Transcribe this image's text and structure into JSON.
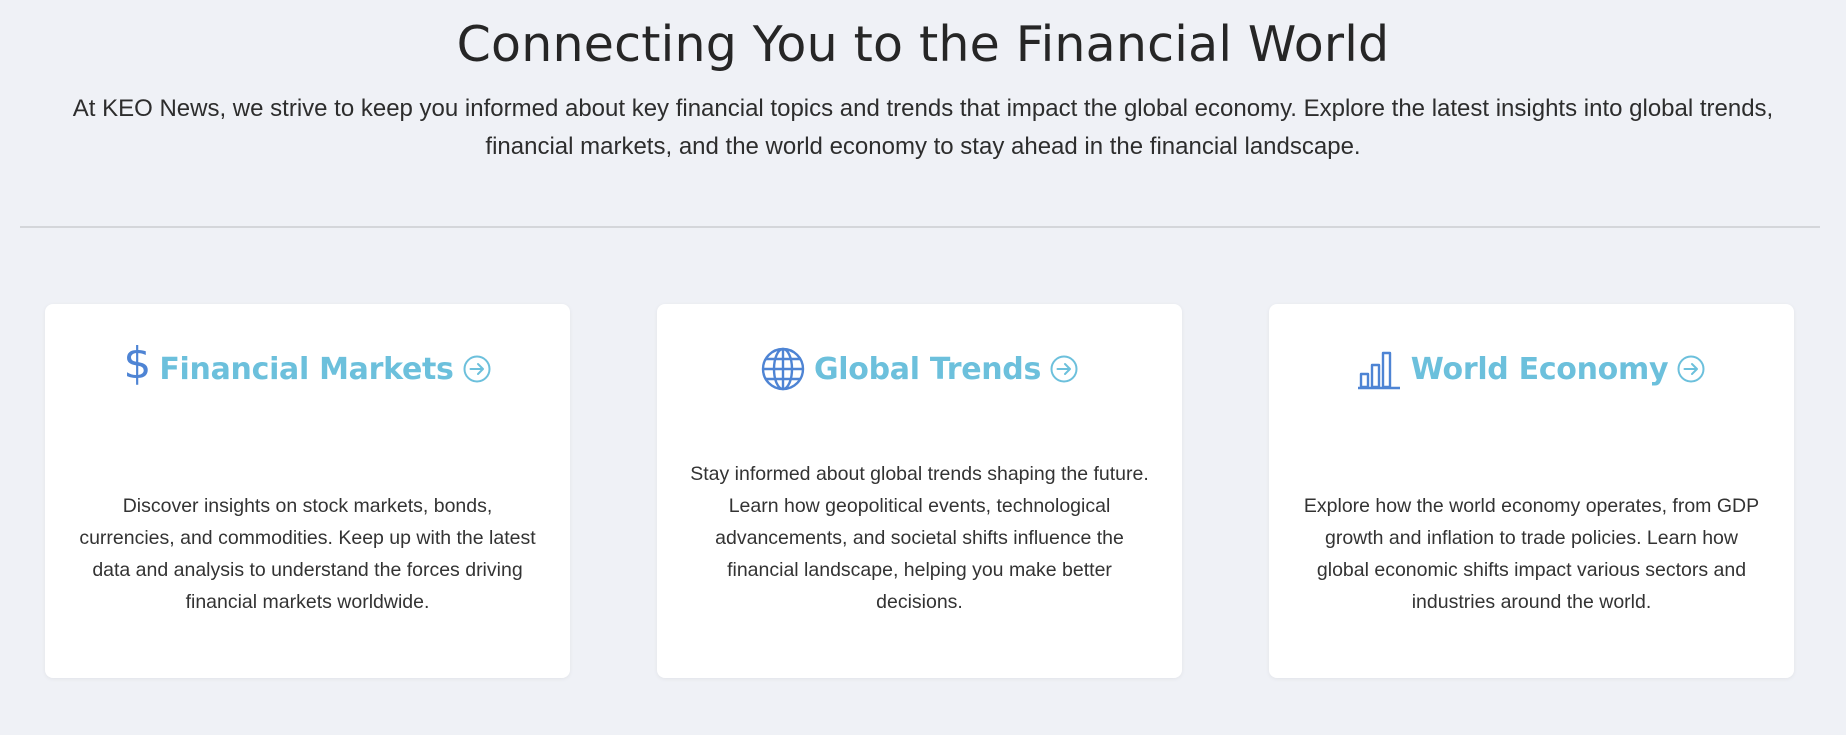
{
  "hero": {
    "title": "Connecting You to the Financial World",
    "subtitle": "At KEO News, we strive to keep you informed about key financial topics and trends that impact the global economy. Explore the latest insights into global trends, financial markets, and the world economy to stay ahead in the financial landscape."
  },
  "colors": {
    "background": "#eff1f6",
    "title_accent": "#6cc0dc",
    "icon_blue": "#4e84d4",
    "card_background": "#ffffff"
  },
  "cards": [
    {
      "icon": "dollar-icon",
      "title": "Financial Markets",
      "body": "Discover insights on stock markets, bonds, currencies, and commodities. Keep up with the latest data and analysis to understand the forces driving financial markets worldwide."
    },
    {
      "icon": "globe-icon",
      "title": "Global Trends",
      "body": "Stay informed about global trends shaping the future. Learn how geopolitical events, technological advancements, and societal shifts influence the financial landscape, helping you make better decisions."
    },
    {
      "icon": "bar-chart-icon",
      "title": "World Economy",
      "body": "Explore how the world economy operates, from GDP growth and inflation to trade policies. Learn how global economic shifts impact various sectors and industries around the world."
    }
  ]
}
